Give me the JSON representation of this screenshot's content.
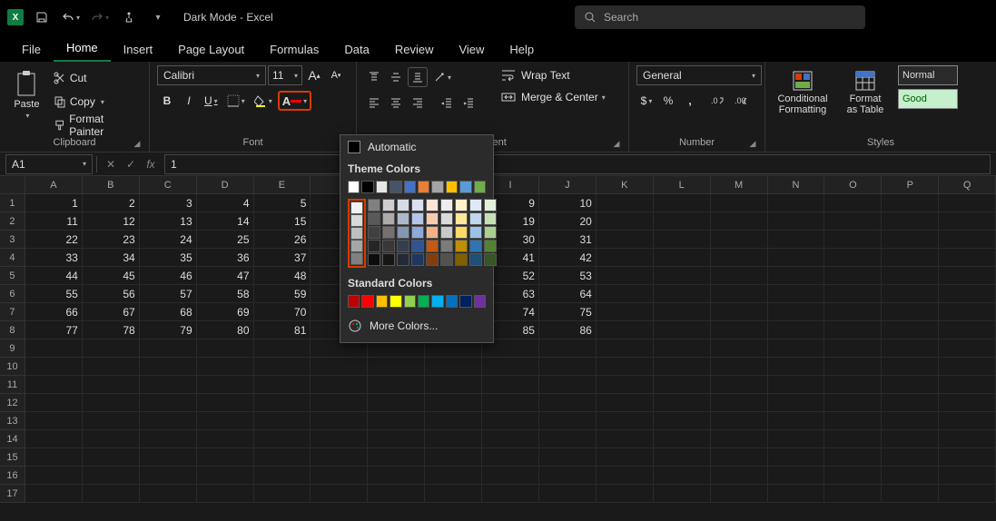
{
  "title": "Dark Mode - Excel",
  "search_placeholder": "Search",
  "tabs": [
    "File",
    "Home",
    "Insert",
    "Page Layout",
    "Formulas",
    "Data",
    "Review",
    "View",
    "Help"
  ],
  "active_tab": 1,
  "clipboard": {
    "paste": "Paste",
    "cut": "Cut",
    "copy": "Copy",
    "format_painter": "Format Painter",
    "label": "Clipboard"
  },
  "font": {
    "name": "Calibri",
    "size": "11",
    "label": "Font"
  },
  "alignment": {
    "wrap": "Wrap Text",
    "merge": "Merge & Center",
    "label": "nment"
  },
  "number": {
    "format": "General",
    "label": "Number"
  },
  "styles": {
    "conditional": "Conditional Formatting",
    "table": "Format as Table",
    "normal": "Normal",
    "good": "Good",
    "label": "Styles"
  },
  "namebox": "A1",
  "formula": "1",
  "columns": [
    "A",
    "B",
    "C",
    "D",
    "E",
    "",
    "",
    "",
    "I",
    "J",
    "K",
    "L",
    "M",
    "N",
    "O",
    "P",
    "Q"
  ],
  "rows": [
    [
      "1",
      "2",
      "3",
      "4",
      "5",
      "",
      "",
      "",
      "9",
      "10",
      "",
      "",
      "",
      "",
      "",
      "",
      ""
    ],
    [
      "11",
      "12",
      "13",
      "14",
      "15",
      "",
      "",
      "",
      "19",
      "20",
      "",
      "",
      "",
      "",
      "",
      "",
      ""
    ],
    [
      "22",
      "23",
      "24",
      "25",
      "26",
      "",
      "",
      "",
      "30",
      "31",
      "",
      "",
      "",
      "",
      "",
      "",
      ""
    ],
    [
      "33",
      "34",
      "35",
      "36",
      "37",
      "",
      "",
      "",
      "41",
      "42",
      "",
      "",
      "",
      "",
      "",
      "",
      ""
    ],
    [
      "44",
      "45",
      "46",
      "47",
      "48",
      "",
      "",
      "",
      "52",
      "53",
      "",
      "",
      "",
      "",
      "",
      "",
      ""
    ],
    [
      "55",
      "56",
      "57",
      "58",
      "59",
      "",
      "",
      "",
      "63",
      "64",
      "",
      "",
      "",
      "",
      "",
      "",
      ""
    ],
    [
      "66",
      "67",
      "68",
      "69",
      "70",
      "",
      "",
      "",
      "74",
      "75",
      "",
      "",
      "",
      "",
      "",
      "",
      ""
    ],
    [
      "77",
      "78",
      "79",
      "80",
      "81",
      "",
      "",
      "",
      "85",
      "86",
      "",
      "",
      "",
      "",
      "",
      "",
      ""
    ]
  ],
  "row_count": 17,
  "colorpicker": {
    "automatic": "Automatic",
    "theme": "Theme Colors",
    "standard": "Standard Colors",
    "more": "More Colors...",
    "theme_row": [
      "#ffffff",
      "#000000",
      "#e7e6e6",
      "#44546a",
      "#4472c4",
      "#ed7d31",
      "#a5a5a5",
      "#ffc000",
      "#5b9bd5",
      "#70ad47"
    ],
    "theme_variants": [
      [
        "#f2f2f2",
        "#d9d9d9",
        "#bfbfbf",
        "#a6a6a6",
        "#808080"
      ],
      [
        "#808080",
        "#595959",
        "#404040",
        "#262626",
        "#0d0d0d"
      ],
      [
        "#d0cece",
        "#aeaaaa",
        "#757171",
        "#3a3838",
        "#161616"
      ],
      [
        "#d6dce5",
        "#adb9ca",
        "#8497b0",
        "#333f50",
        "#222a35"
      ],
      [
        "#d9e1f2",
        "#b4c6e7",
        "#8ea9db",
        "#305496",
        "#203764"
      ],
      [
        "#fbe5d6",
        "#f8cbad",
        "#f4b183",
        "#c65911",
        "#843c0c"
      ],
      [
        "#ededed",
        "#dbdbdb",
        "#c9c9c9",
        "#7b7b7b",
        "#525252"
      ],
      [
        "#fff2cc",
        "#ffe699",
        "#ffd966",
        "#bf8f00",
        "#806000"
      ],
      [
        "#deebf7",
        "#bdd7ee",
        "#9bc2e6",
        "#2f75b5",
        "#1f4e78"
      ],
      [
        "#e2efda",
        "#c6e0b4",
        "#a9d08e",
        "#548235",
        "#375623"
      ]
    ],
    "standard_row": [
      "#c00000",
      "#ff0000",
      "#ffc000",
      "#ffff00",
      "#92d050",
      "#00b050",
      "#00b0f0",
      "#0070c0",
      "#002060",
      "#7030a0"
    ]
  }
}
